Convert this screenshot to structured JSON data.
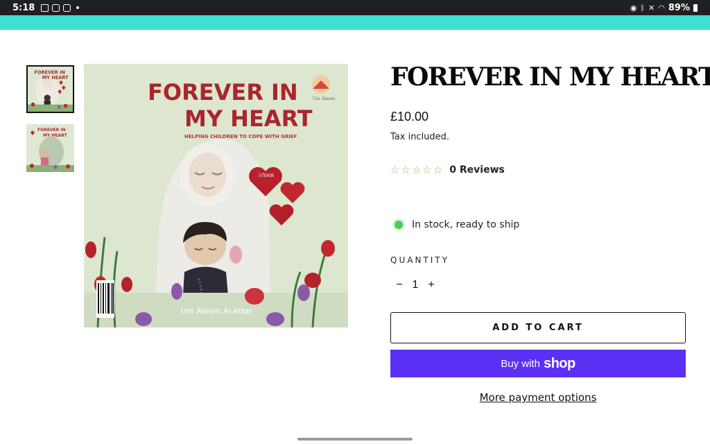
{
  "status_bar": {
    "time": "5:18",
    "battery": "89%",
    "left_icons": [
      "image-icon",
      "instagram-icon",
      "instagram-icon",
      "dot-icon"
    ],
    "right_icons": [
      "alarm-icon",
      "bluetooth-icon",
      "mute-icon",
      "wifi-icon",
      "battery-icon"
    ]
  },
  "colors": {
    "announcement_bar": "#3fe0d0",
    "shop_button": "#5a31f4",
    "in_stock": "#4ec95b"
  },
  "gallery": {
    "thumbnails": [
      {
        "name": "cover-thumbnail",
        "active": true
      },
      {
        "name": "back-cover-thumbnail",
        "active": false
      }
    ],
    "cover": {
      "title_line1": "FOREVER IN",
      "title_line2": "MY HEART",
      "subtitle": "HELPING CHILDREN TO COPE WITH GRIEF",
      "badge": "2 in 1 flip over books",
      "author": "Um Aimen Al-Attar",
      "publisher_logo": "Um Aimen"
    }
  },
  "product": {
    "title": "FOREVER IN MY HEART",
    "price": "£10.00",
    "tax_note": "Tax included.",
    "rating": 0,
    "reviews_label": "0 Reviews",
    "stock_status": "In stock, ready to ship",
    "quantity_label": "QUANTITY",
    "quantity": "1",
    "add_to_cart": "ADD TO CART",
    "buy_with": "Buy with",
    "shop_brand": "shop",
    "more_payment": "More payment options"
  }
}
